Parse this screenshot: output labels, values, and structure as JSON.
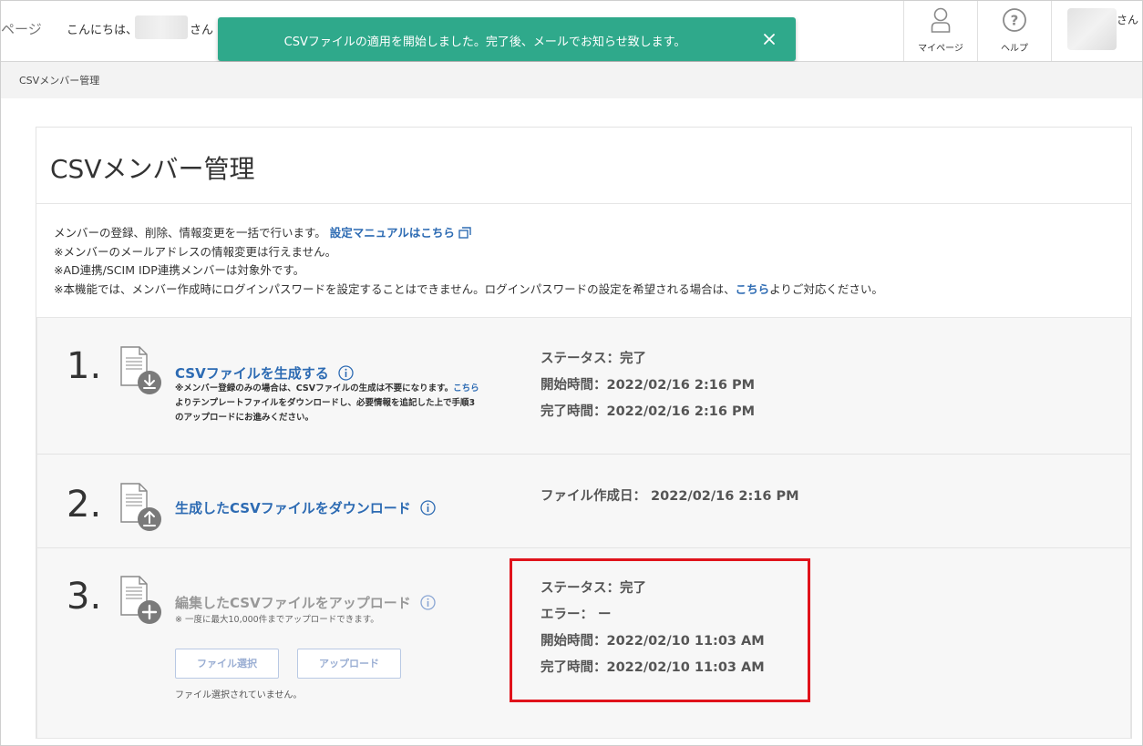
{
  "header": {
    "page_fragment": "ページ",
    "greeting": "こんにちは、",
    "greeting_suffix": "さん",
    "mypage_label": "マイページ",
    "help_label": "ヘルプ",
    "user_suffix": "さん"
  },
  "toast": {
    "message": "CSVファイルの適用を開始しました。完了後、メールでお知らせ致します。"
  },
  "breadcrumb": "CSVメンバー管理",
  "page_title": "CSVメンバー管理",
  "notes": {
    "line1": "メンバーの登録、削除、情報変更を一括で行います。",
    "manual_link": "設定マニュアルはこちら",
    "line2": "※メンバーのメールアドレスの情報変更は行えません。",
    "line3": "※AD連携/SCIM IDP連携メンバーは対象外です。",
    "line4_pre": "※本機能では、メンバー作成時にログインパスワードを設定することはできません。ログインパスワードの設定を希望される場合は、",
    "line4_link": "こちら",
    "line4_post": "よりご対応ください。"
  },
  "steps": {
    "step1": {
      "number": "1.",
      "title": "CSVファイルを生成する",
      "note_pre": "※メンバー登録のみの場合は、CSVファイルの生成は不要になります。",
      "note_link": "こちら",
      "note_line2": "よりテンプレートファイルをダウンロードし、必要情報を追記した上で手順3",
      "note_line3": "のアップロードにお進みください。",
      "status": "ステータス：完了",
      "start": "開始時間：2022/02/16 2:16 PM",
      "end": "完了時間：2022/02/16 2:16 PM"
    },
    "step2": {
      "number": "2.",
      "title": "生成したCSVファイルをダウンロード",
      "created": "ファイル作成日： 2022/02/16 2:16 PM"
    },
    "step3": {
      "number": "3.",
      "title": "編集したCSVファイルをアップロード",
      "note": "※ 一度に最大10,000件までアップロードできます。",
      "select_button": "ファイル選択",
      "upload_button": "アップロード",
      "no_file": "ファイル選択されていません。",
      "status": "ステータス：完了",
      "error": "エラー： ー",
      "start": "開始時間：2022/02/10 11:03 AM",
      "end": "完了時間：2022/02/10 11:03 AM"
    }
  },
  "colors": {
    "toast": "#2fa98b",
    "link": "#2d6bb3",
    "highlight": "#e0131b"
  }
}
